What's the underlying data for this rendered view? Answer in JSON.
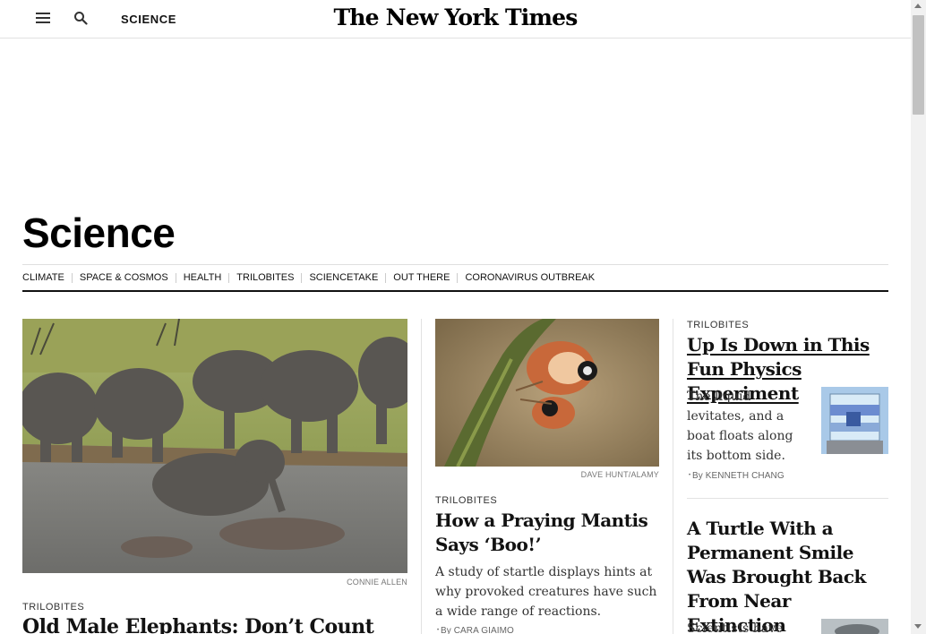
{
  "header": {
    "menu_icon": "hamburger-menu-icon",
    "search_icon": "search-icon",
    "section": "SCIENCE",
    "masthead": "The New York Times"
  },
  "page": {
    "title": "Science"
  },
  "subnav": {
    "items": [
      "CLIMATE",
      "SPACE & COSMOS",
      "HEALTH",
      "TRILOBITES",
      "SCIENCETAKE",
      "OUT THERE",
      "CORONAVIRUS OUTBREAK"
    ]
  },
  "lead": {
    "credit": "CONNIE ALLEN",
    "kicker": "TRILOBITES",
    "headline": "Old Male Elephants: Don’t Count Them Out"
  },
  "mantis": {
    "credit": "DAVE HUNT/ALAMY",
    "kicker": "TRILOBITES",
    "headline": "How a Praying Mantis Says ‘Boo!’",
    "summary": "A study of startle displays hints at why provoked creatures have such a wide range of reactions.",
    "byline": "By CARA GIAIMO"
  },
  "physics": {
    "kicker": "TRILOBITES",
    "headline": "Up Is Down in This Fun Physics Experiment",
    "summary": "The liquid levitates, and a boat floats along its bottom side.",
    "byline": "By KENNETH CHANG"
  },
  "turtle": {
    "headline": "A Turtle With a Permanent Smile Was Brought Back From Near Extinction",
    "summary": "Scientists have"
  },
  "colors": {
    "text": "#121212",
    "muted": "#777777",
    "divider": "#e2e2e2"
  }
}
